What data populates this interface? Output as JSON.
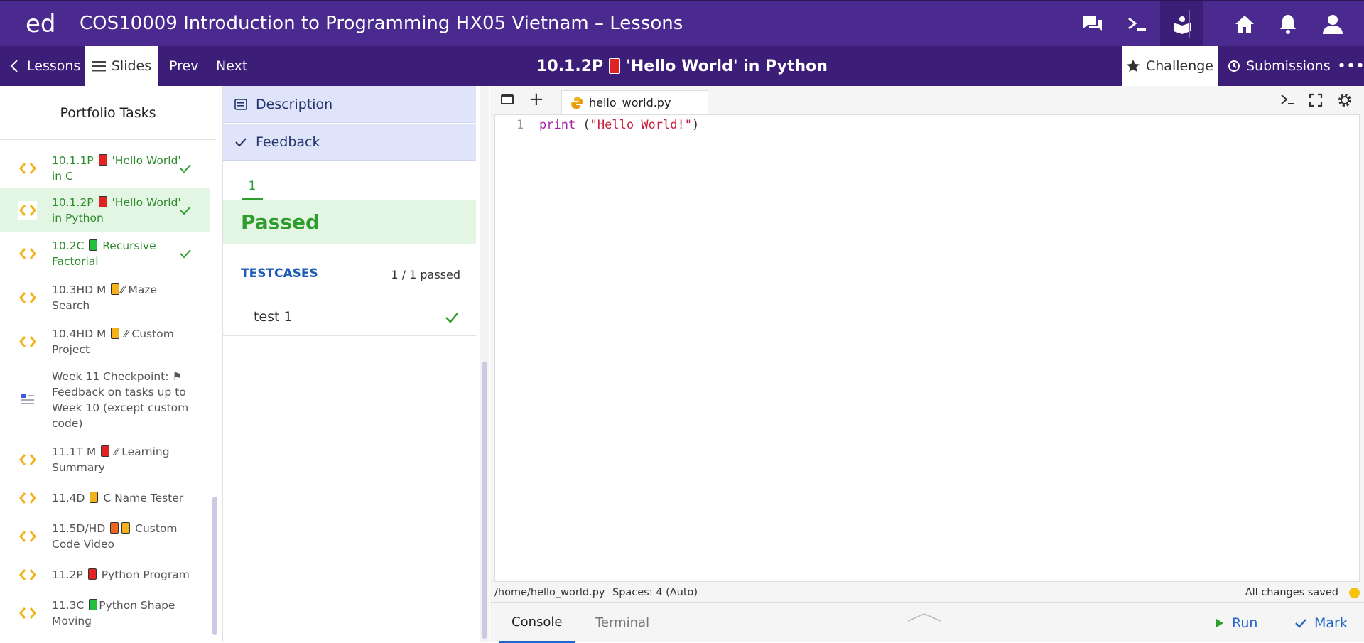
{
  "topbar": {
    "logo": "ed",
    "title": "COS10009 Introduction to Programming HX05 Vietnam – Lessons",
    "icons": [
      "discussion-icon",
      "terminal-icon",
      "lessons-icon",
      "home-icon",
      "bell-icon",
      "user-icon"
    ]
  },
  "subbar": {
    "lessons": "Lessons",
    "slides": "Slides",
    "prev": "Prev",
    "next": "Next",
    "lesson_code": "10.1.2P",
    "lesson_name": "'Hello World' in Python",
    "challenge": "Challenge",
    "submissions": "Submissions"
  },
  "sidebar": {
    "title": "Portfolio Tasks",
    "tasks": [
      {
        "code": "10.1.1P",
        "name": "'Hello World' in C"
      },
      {
        "code": "10.1.2P",
        "name": "'Hello World' in Python"
      },
      {
        "code": "10.2C",
        "name": "Recursive Factorial"
      },
      {
        "code": "10.3HD M",
        "name": "Maze Search"
      },
      {
        "code": "10.4HD M",
        "name": "Custom Project"
      },
      {
        "code": "Week 11 Checkpoint:",
        "name": "Feedback on tasks up to Week 10 (except custom code)"
      },
      {
        "code": "11.1T M",
        "name": "Learning Summary"
      },
      {
        "code": "11.4D",
        "name": "C Name Tester"
      },
      {
        "code": "11.5D/HD",
        "name": "Custom Code Video"
      },
      {
        "code": "11.2P",
        "name": "Python Program"
      },
      {
        "code": "11.3C",
        "name": "Python Shape Moving"
      }
    ]
  },
  "feedback": {
    "description_tab": "Description",
    "feedback_tab": "Feedback",
    "run_number": "1",
    "status": "Passed",
    "testcases_label": "TESTCASES",
    "passed_count": "1 / 1 passed",
    "tests": [
      {
        "name": "test 1",
        "result": "pass"
      }
    ]
  },
  "editor": {
    "filename": "hello_world.py",
    "line_number": "1",
    "code_keyword": "print",
    "code_open": " (",
    "code_string": "\"Hello World!\"",
    "code_close": ")",
    "path": "/home/hello_world.py",
    "spaces": "Spaces: 4 (Auto)",
    "save_status": "All changes saved",
    "console_tab": "Console",
    "terminal_tab": "Terminal",
    "run": "Run",
    "mark": "Mark"
  },
  "colors": {
    "topbar": "#4b2a8f",
    "subbar": "#3c1d78",
    "passed_green": "#2e9d2e",
    "link_blue": "#1e66c8"
  }
}
